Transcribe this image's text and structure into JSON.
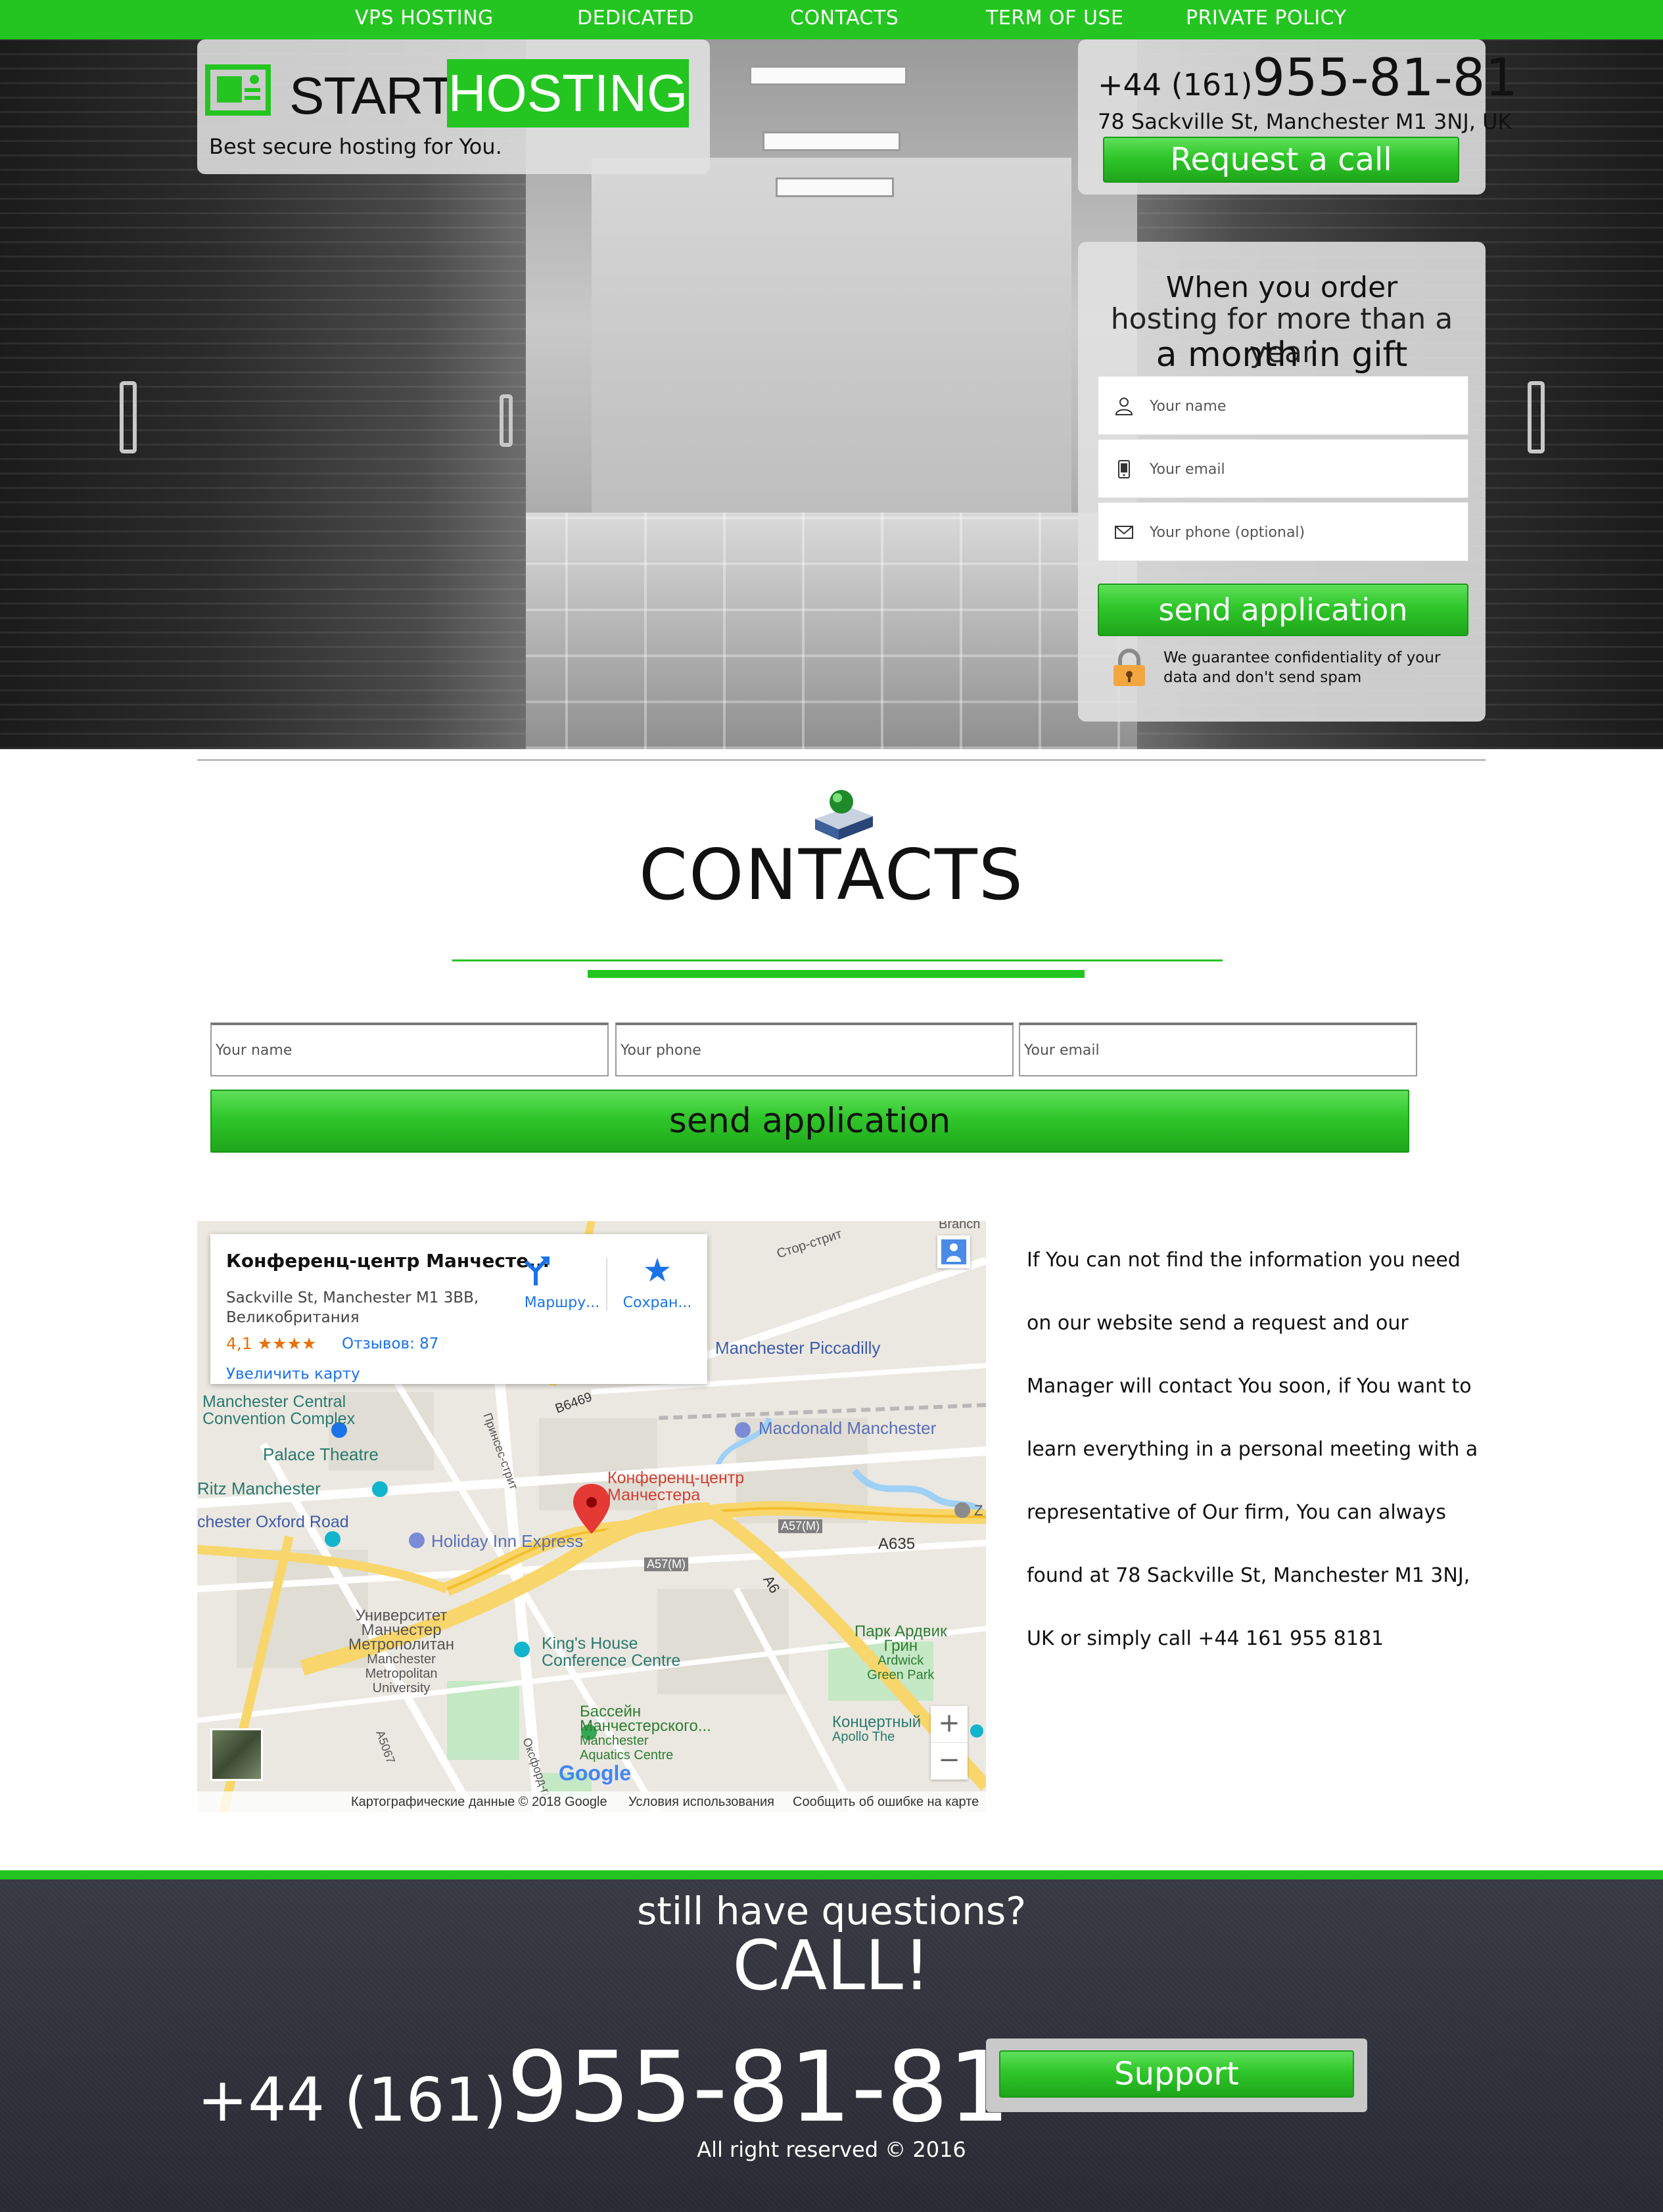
{
  "nav": {
    "items": [
      {
        "label": "VPS HOSTING"
      },
      {
        "label": "DEDICATED"
      },
      {
        "label": "CONTACTS"
      },
      {
        "label": "TERM OF USE"
      },
      {
        "label": "PRIVATE POLICY"
      }
    ]
  },
  "brand": {
    "logo_start": "START",
    "logo_hosting": "HOSTING",
    "tagline": "Best secure hosting for You."
  },
  "header_contact": {
    "phone_prefix": "+44 (161)",
    "phone_number": "955-81-81",
    "address": "78 Sackville St, Manchester M1 3NJ, UK",
    "request_button": "Request a call"
  },
  "offer_form": {
    "line1": "When you order",
    "line2": "hosting for more than a year",
    "line3": "a month in gift",
    "name_placeholder": "Your name",
    "email_placeholder": "Your email",
    "phone_placeholder": "Your phone (optional)",
    "submit_label": "send application",
    "guarantee_text": "We guarantee confidentiality of your data and don't send spam"
  },
  "contacts_section": {
    "title": "CONTACTS",
    "name_placeholder": "Your name",
    "phone_placeholder": "Your phone",
    "email_placeholder": "Your email",
    "submit_label": "send application"
  },
  "map": {
    "card": {
      "place_name": "Конференц-центр Манчесте...",
      "address": "Sackville St, Manchester M1 3BB, Великобритания",
      "rating_value": "4,1",
      "rating_stars": "★★★★",
      "reviews": "Отзывов: 87",
      "enlarge_link": "Увеличить карту",
      "route_label": "Маршру...",
      "save_label": "Сохран..."
    },
    "labels": {
      "pin_label_1": "Конференц-центр",
      "pin_label_2": "Манчестера",
      "convention_1": "Manchester Central",
      "convention_2": "Convention Complex",
      "palace": "Palace Theatre",
      "ritz": "Ritz Manchester",
      "oxford_road": "chester Oxford Road",
      "holiday_inn": "Holiday Inn Express",
      "piccadilly": "Manchester Piccadilly",
      "macdonald": "Macdonald Manchester",
      "a635": "A635",
      "a57m_1": "A57(M)",
      "a57m_2": "A57(M)",
      "a6": "A6",
      "b6469": "B6469",
      "uni_1": "Университет",
      "uni_2": "Манчестер",
      "uni_3": "Метрополитан",
      "uni_4": "Manchester",
      "uni_5": "Metropolitan",
      "uni_6": "University",
      "kings_1": "King's House",
      "kings_2": "Conference Centre",
      "park_1": "Парк Ардвик",
      "park_2": "Грин",
      "park_3": "Ardwick",
      "park_4": "Green Park",
      "pool_1": "Бассейн",
      "pool_2": "Манчестерского...",
      "pool_3": "Manchester",
      "pool_4": "Aquatics Centre",
      "concert_1": "Концертный",
      "concert_2": "Apollo The",
      "a5067": "A5067",
      "stor": "Стор-стрит",
      "princess": "Принсес-стрит",
      "oxford_st": "Оксфорд-р",
      "branch": "Branch",
      "z": "Z"
    },
    "google_logo": "Google",
    "footer_data": "Картографические данные © 2018 Google",
    "footer_terms": "Условия использования",
    "footer_report": "Сообщить об ошибке на карте",
    "zoom_in": "+",
    "zoom_out": "−"
  },
  "info_text": "If You can not find the information you need on our website send a request and our Manager will contact You soon, if You want to learn everything in a personal meeting with a representative of Our firm, You can always found at 78 Sackville St, Manchester M1 3NJ, UK or simply call +44 161 955 8181",
  "footer": {
    "question": "still have questions?",
    "call": "CALL!",
    "phone_prefix": "+44 (161)",
    "phone_number": "955-81-81",
    "support_button": "Support",
    "copyright": "All right reserved © 2016"
  },
  "colors": {
    "brand_green": "#24c520",
    "footer_dark": "#2f2f3a",
    "link_blue": "#1a73e8"
  }
}
